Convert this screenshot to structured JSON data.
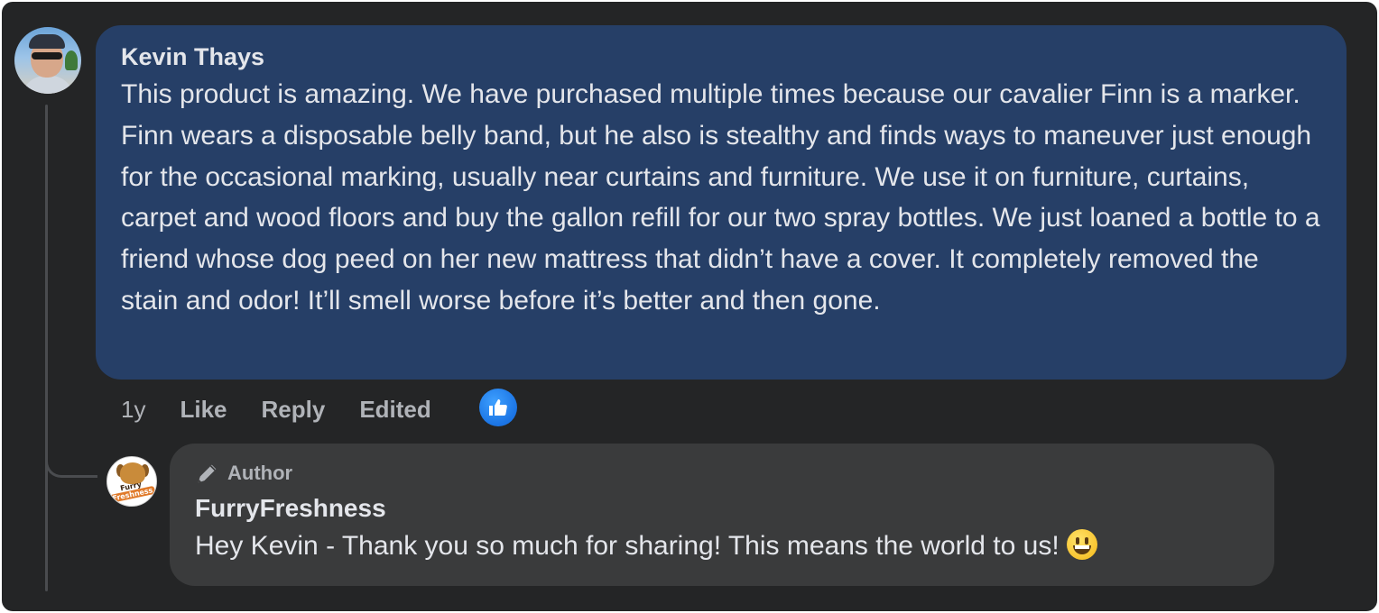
{
  "comment": {
    "author": "Kevin Thays",
    "text": "This product is amazing. We have purchased multiple times because our cavalier Finn is a marker. Finn wears a disposable belly band, but he also is stealthy and finds ways to maneuver just enough for the occasional marking, usually near curtains and furniture. We use it on furniture, curtains, carpet and wood floors and buy the gallon refill for our two spray bottles. We just loaned a bottle to a friend whose dog peed on her new mattress that didn’t have a cover. It completely removed the stain and odor! It’ll smell worse before it’s better and then gone.",
    "time": "1y",
    "like_label": "Like",
    "reply_label": "Reply",
    "edited_label": "Edited",
    "reaction_icon": "thumbs-up-icon",
    "bubble_color": "#263f67"
  },
  "reply": {
    "role_badge": "Author",
    "role_icon": "pen-icon",
    "author": "FurryFreshness",
    "text": "Hey Kevin - Thank you so much for sharing! This means the world to us!",
    "emoji": "grinning-face-emoji",
    "avatar_logo_line1": "Furry",
    "avatar_logo_line2": "Freshness",
    "bubble_color": "#3a3b3c"
  },
  "theme": {
    "background": "#242526",
    "text": "#e4e6eb",
    "secondary_text": "#b0b3b8",
    "like_blue": "#1b74e4"
  }
}
